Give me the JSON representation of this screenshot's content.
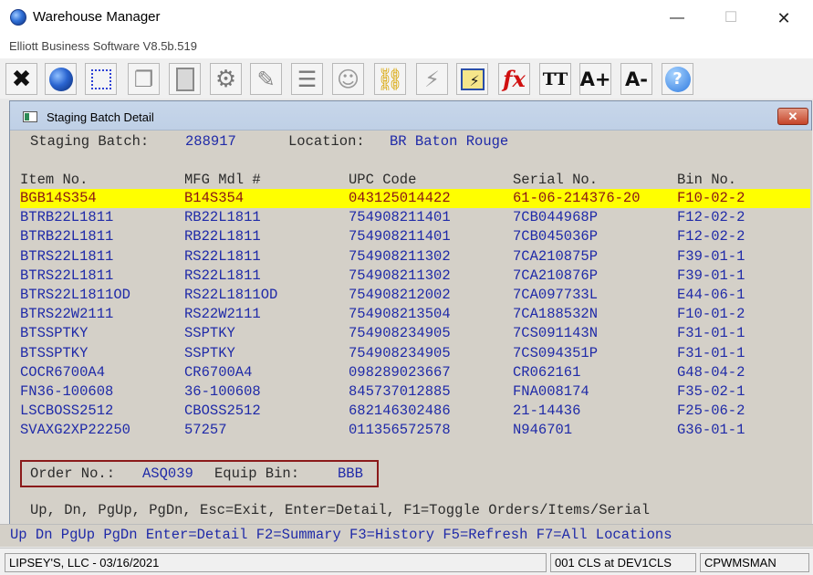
{
  "window": {
    "title": "Warehouse Manager",
    "subtitle": "Elliott Business Software V8.5b.519",
    "minimize": "—",
    "maximize": "☐",
    "close": "✕"
  },
  "toolbar": {
    "icons": [
      "exit-icon",
      "globe-icon",
      "select-icon",
      "copy-icon",
      "paste-icon",
      "settings-icon",
      "edit-icon",
      "list-icon",
      "users-icon",
      "link-icon",
      "lightning-icon",
      "calculator-icon",
      "fx-icon",
      "font-icon",
      "font-increase-icon",
      "font-decrease-icon",
      "help-icon"
    ],
    "glyphs": {
      "exit": "✖",
      "globe": "●",
      "select": "⬚",
      "copy": "❐",
      "paste": "📋",
      "settings": "⚙",
      "edit": "✎",
      "list": "☰",
      "users": "☺",
      "link": "⛓",
      "lightning": "⚡",
      "calc": "▦",
      "fx": "fx",
      "font": "TT",
      "font_up": "A+",
      "font_down": "A-",
      "help": "?"
    }
  },
  "child_window": {
    "title": "Staging Batch Detail",
    "close": "✕"
  },
  "header": {
    "batch_label": "Staging Batch:",
    "batch_value": "288917",
    "location_label": "Location:",
    "location_value": "BR Baton Rouge"
  },
  "table": {
    "columns": [
      "Item No.",
      "MFG Mdl #",
      "UPC Code",
      "Serial No.",
      "Bin No."
    ],
    "rows": [
      [
        "BGB14S354",
        "B14S354",
        "043125014422",
        "61-06-214376-20",
        "F10-02-2"
      ],
      [
        "BTRB22L1811",
        "RB22L1811",
        "754908211401",
        "7CB044968P",
        "F12-02-2"
      ],
      [
        "BTRB22L1811",
        "RB22L1811",
        "754908211401",
        "7CB045036P",
        "F12-02-2"
      ],
      [
        "BTRS22L1811",
        "RS22L1811",
        "754908211302",
        "7CA210875P",
        "F39-01-1"
      ],
      [
        "BTRS22L1811",
        "RS22L1811",
        "754908211302",
        "7CA210876P",
        "F39-01-1"
      ],
      [
        "BTRS22L1811OD",
        "RS22L1811OD",
        "754908212002",
        "7CA097733L",
        "E44-06-1"
      ],
      [
        "BTRS22W2111",
        "RS22W2111",
        "754908213504",
        "7CA188532N",
        "F10-01-2"
      ],
      [
        "BTSSPTKY",
        "SSPTKY",
        "754908234905",
        "7CS091143N",
        "F31-01-1"
      ],
      [
        "BTSSPTKY",
        "SSPTKY",
        "754908234905",
        "7CS094351P",
        "F31-01-1"
      ],
      [
        "COCR6700A4",
        "CR6700A4",
        "098289023667",
        "CR062161",
        "G48-04-2"
      ],
      [
        "FN36-100608",
        "36-100608",
        "845737012885",
        "FNA008174",
        "F35-02-1"
      ],
      [
        "LSCBOSS2512",
        "CBOSS2512",
        "682146302486",
        "21-14436",
        "F25-06-2"
      ],
      [
        "SVAXG2XP22250",
        "57257",
        "011356572578",
        "N946701",
        "G36-01-1"
      ]
    ],
    "selected_row": 0
  },
  "footer": {
    "order_label": "Order No.:",
    "order_value": "ASQ039",
    "equip_label": "Equip Bin:",
    "equip_value": "BBB",
    "hint": "Up, Dn, PgUp, PgDn, Esc=Exit, Enter=Detail, F1=Toggle Orders/Items/Serial"
  },
  "keybar": "Up Dn PgUp PgDn Enter=Detail F2=Summary F3=History F5=Refresh F7=All Locations",
  "statusbar": {
    "company": "LIPSEY'S, LLC - 03/16/2021",
    "station": "001 CLS at DEV1CLS",
    "user": "CPWMSMAN"
  },
  "colors": {
    "selected_row": "#ffff00",
    "data_text": "#1f2aa8",
    "selected_text": "#8a1515",
    "order_box_border": "#8b1a1a"
  }
}
